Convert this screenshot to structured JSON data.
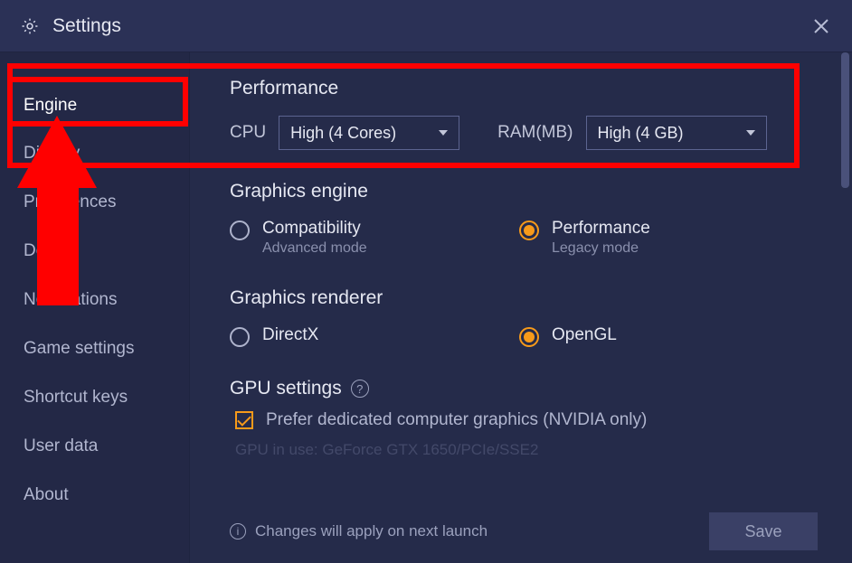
{
  "header": {
    "title": "Settings"
  },
  "sidebar": {
    "items": [
      {
        "label": "Engine",
        "active": true
      },
      {
        "label": "Display"
      },
      {
        "label": "Preferences"
      },
      {
        "label": "Device"
      },
      {
        "label": "Notifications"
      },
      {
        "label": "Game settings"
      },
      {
        "label": "Shortcut keys"
      },
      {
        "label": "User data"
      },
      {
        "label": "About"
      }
    ]
  },
  "performance": {
    "heading": "Performance",
    "cpu_label": "CPU",
    "cpu_value": "High (4 Cores)",
    "ram_label": "RAM(MB)",
    "ram_value": "High (4 GB)"
  },
  "graphics_engine": {
    "heading": "Graphics engine",
    "options": [
      {
        "title": "Compatibility",
        "subtitle": "Advanced mode",
        "selected": false
      },
      {
        "title": "Performance",
        "subtitle": "Legacy mode",
        "selected": true
      }
    ]
  },
  "graphics_renderer": {
    "heading": "Graphics renderer",
    "options": [
      {
        "title": "DirectX",
        "selected": false
      },
      {
        "title": "OpenGL",
        "selected": true
      }
    ]
  },
  "gpu": {
    "heading": "GPU settings",
    "checkbox_label": "Prefer dedicated computer graphics (NVIDIA only)",
    "checked": true,
    "in_use": "GPU in use: GeForce GTX 1650/PCIe/SSE2"
  },
  "footer": {
    "info": "Changes will apply on next launch",
    "save": "Save"
  }
}
